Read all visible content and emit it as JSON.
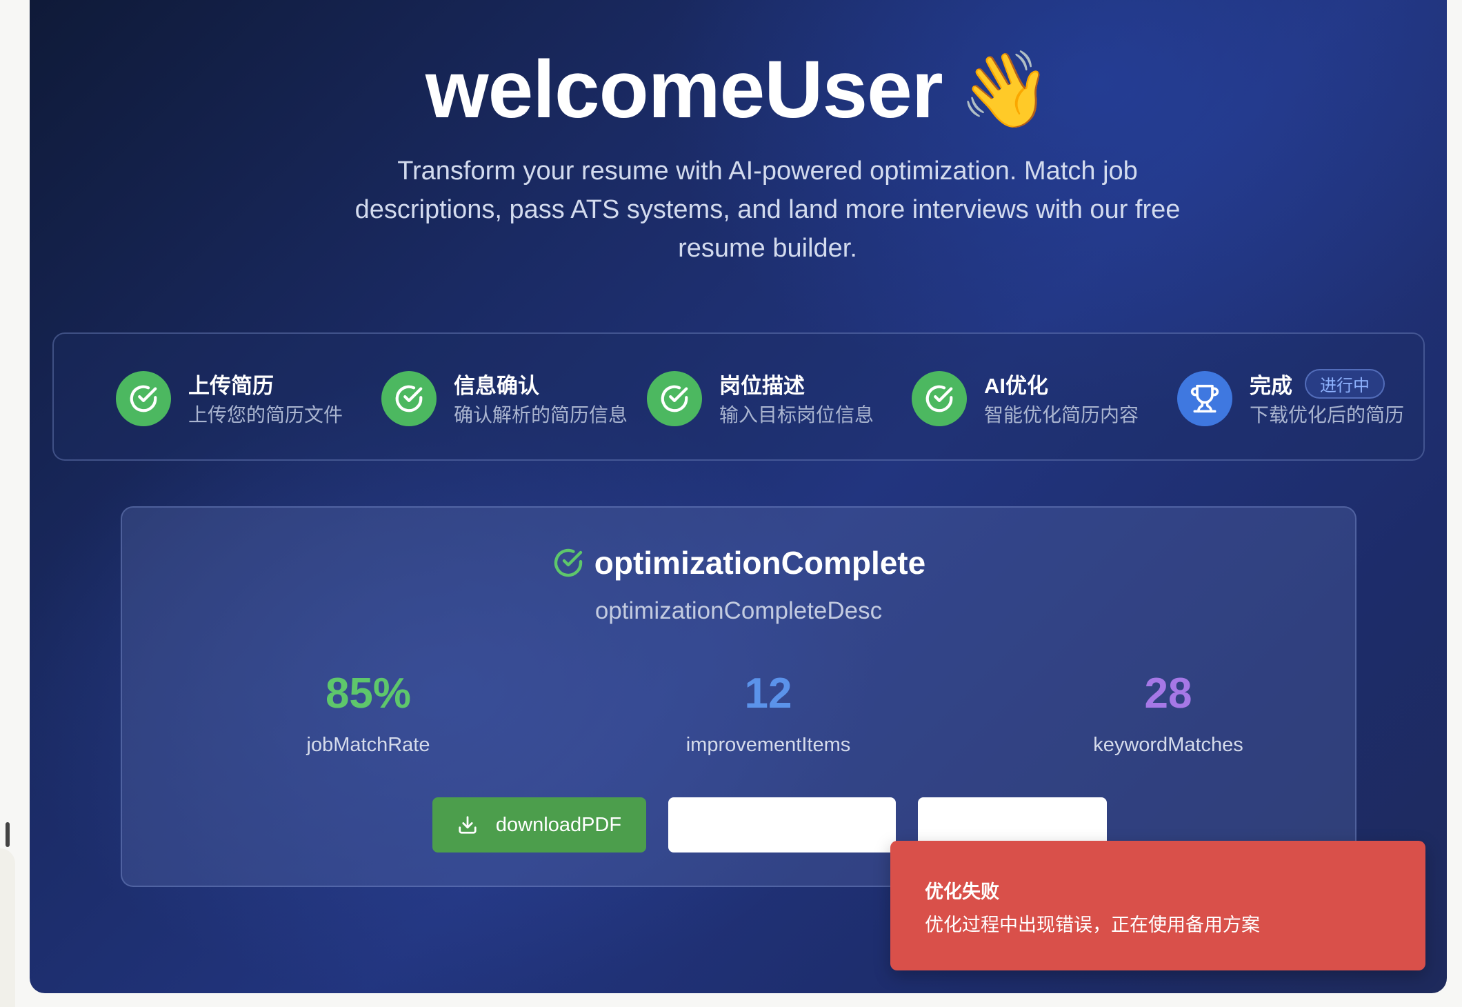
{
  "hero": {
    "title": "welcomeUser",
    "emoji": "👋",
    "subtitle": "Transform your resume with AI-powered optimization. Match job descriptions, pass ATS systems, and land more interviews with our free resume builder."
  },
  "steps": [
    {
      "title": "上传简历",
      "desc": "上传您的简历文件",
      "icon": "check-circle-icon",
      "status": "done"
    },
    {
      "title": "信息确认",
      "desc": "确认解析的简历信息",
      "icon": "check-circle-icon",
      "status": "done"
    },
    {
      "title": "岗位描述",
      "desc": "输入目标岗位信息",
      "icon": "check-circle-icon",
      "status": "done"
    },
    {
      "title": "AI优化",
      "desc": "智能优化简历内容",
      "icon": "check-circle-icon",
      "status": "done"
    },
    {
      "title": "完成",
      "desc": "下载优化后的简历",
      "icon": "trophy-icon",
      "status": "current",
      "tag": "进行中"
    }
  ],
  "result": {
    "title": "optimizationComplete",
    "description": "optimizationCompleteDesc",
    "stats": [
      {
        "value": "85%",
        "label": "jobMatchRate",
        "color": "#5ec76b"
      },
      {
        "value": "12",
        "label": "improvementItems",
        "color": "#5b93ea"
      },
      {
        "value": "28",
        "label": "keywordMatches",
        "color": "#a678e6"
      }
    ],
    "download_label": "downloadPDF"
  },
  "toast": {
    "title": "优化失败",
    "message": "优化过程中出现错误，正在使用备用方案"
  },
  "colors": {
    "success": "#4cb860",
    "current": "#3f78e0",
    "download_button": "#4c9e4c",
    "toast_bg": "#d9504a"
  }
}
